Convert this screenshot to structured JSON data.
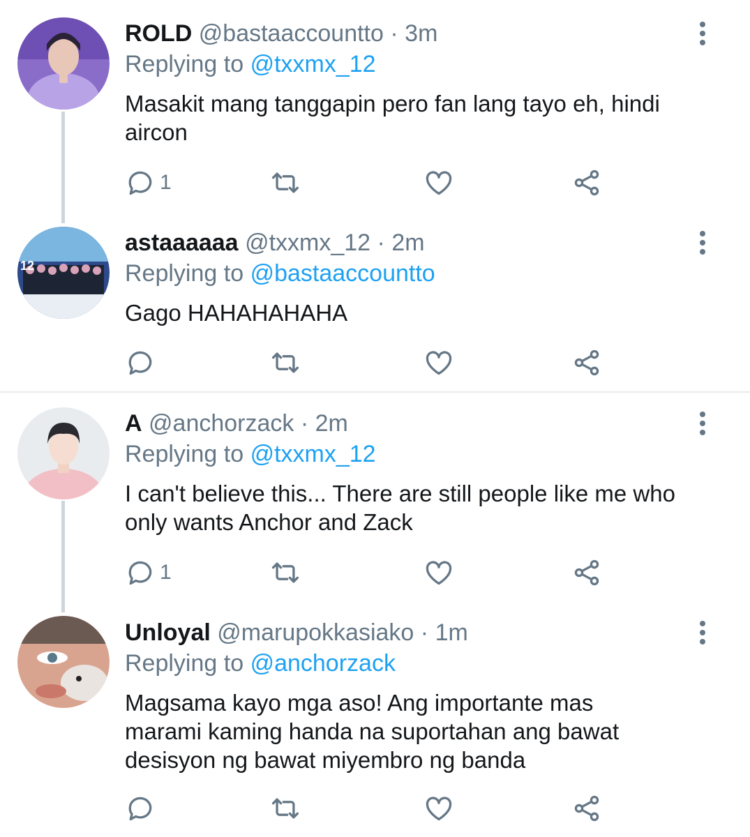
{
  "tweets": [
    {
      "name": "ROLD",
      "handle": "@bastaaccountto",
      "time": "3m",
      "replying_prefix": "Replying to",
      "replying_to": "@txxmx_12",
      "text": "Masakit mang tanggapin pero fan lang tayo eh, hindi aircon",
      "reply_count": "1"
    },
    {
      "name": "astaaaaaa",
      "handle": "@txxmx_12",
      "time": "2m",
      "replying_prefix": "Replying to",
      "replying_to": "@bastaaccountto",
      "text": "Gago HAHAHAHAHA",
      "reply_count": ""
    },
    {
      "name": "A",
      "handle": "@anchorzack",
      "time": "2m",
      "replying_prefix": "Replying to",
      "replying_to": "@txxmx_12",
      "text": "I can't believe this... There are still people like me who only wants Anchor and Zack",
      "reply_count": "1"
    },
    {
      "name": "Unloyal",
      "handle": "@marupokkasiako",
      "time": "1m",
      "replying_prefix": "Replying to",
      "replying_to": "@anchorzack",
      "text": "Magsama kayo mga aso! Ang importante mas marami kaming handa na suportahan ang bawat desisyon ng bawat miyembro ng banda",
      "reply_count": ""
    }
  ],
  "separator": "·",
  "colors": {
    "link": "#1da1f2",
    "secondary": "#657786",
    "thread_line": "#ccd6dd"
  },
  "icons": [
    "reply-icon",
    "retweet-icon",
    "like-icon",
    "share-icon",
    "more-options-icon"
  ]
}
